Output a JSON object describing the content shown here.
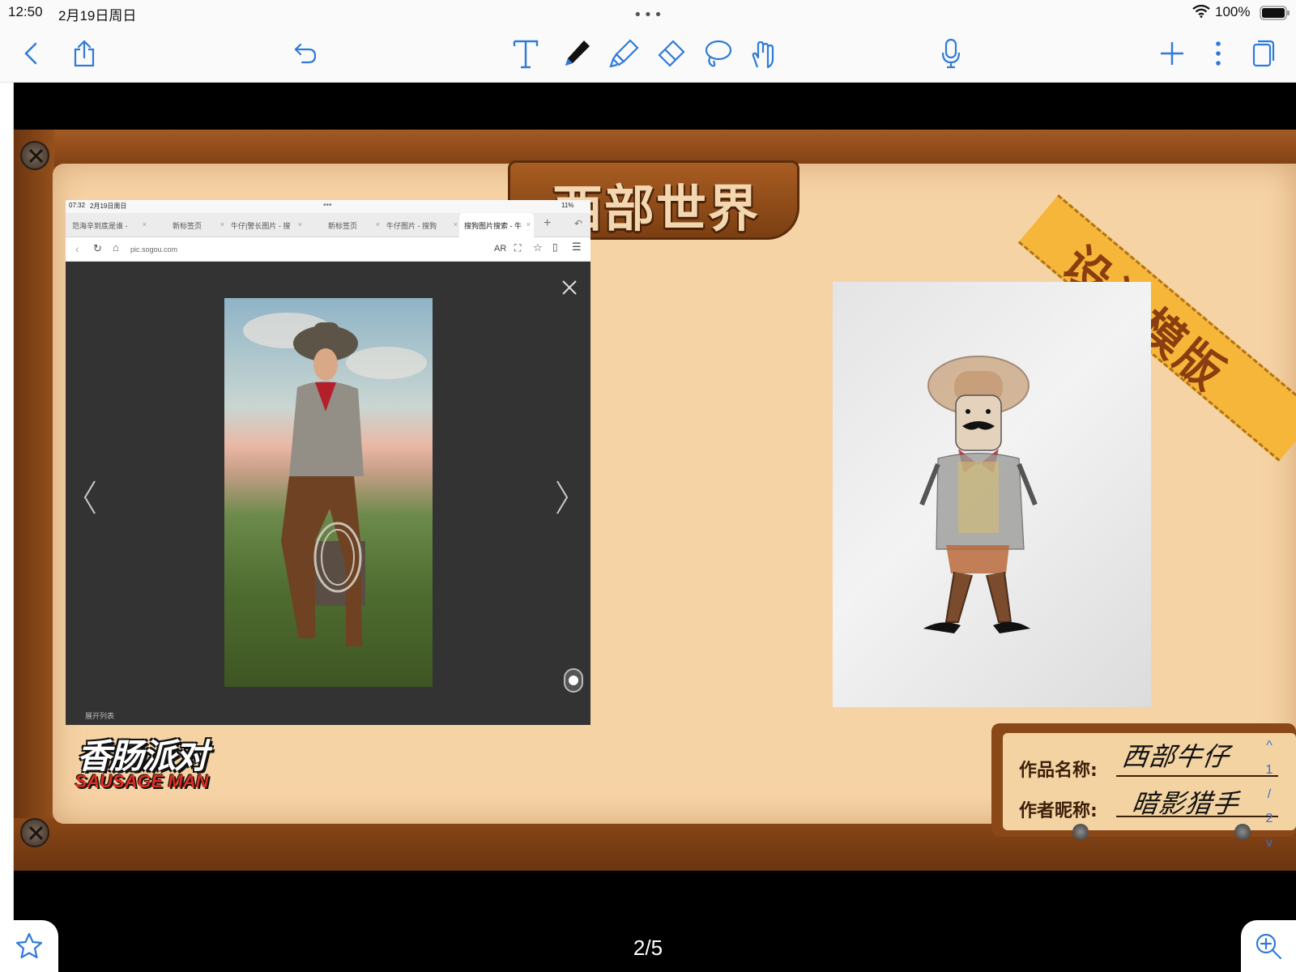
{
  "status_bar": {
    "time": "12:50",
    "date": "2月19日周日",
    "battery": "100%"
  },
  "toolbar": {
    "tools": [
      "back",
      "share",
      "undo",
      "text",
      "pen",
      "highlighter",
      "eraser",
      "lasso",
      "hand",
      "microphone",
      "add",
      "more",
      "pages"
    ],
    "accent_color": "#2f7ad8"
  },
  "slide": {
    "title": "西部世界",
    "ribbon": "设计模版",
    "logo_cn": "香肠派对",
    "logo_en": "SAUSAGE MAN",
    "card": {
      "work_name_label": "作品名称:",
      "work_name_value": "西部牛仔",
      "author_label": "作者昵称:",
      "author_value": "暗影猎手"
    }
  },
  "embedded_screenshot": {
    "time": "07:32",
    "date": "2月19日周日",
    "battery": "11%",
    "tabs": [
      {
        "label": "范海辛到底是谁 -",
        "active": false
      },
      {
        "label": "新标签页",
        "active": false
      },
      {
        "label": "牛仔|警长图片 - 搜",
        "active": false
      },
      {
        "label": "新标签页",
        "active": false
      },
      {
        "label": "牛仔图片 - 搜狗",
        "active": false
      },
      {
        "label": "搜狗图片搜索 - 牛",
        "active": true
      }
    ],
    "url": "pic.sogou.com",
    "ar_label": "AR",
    "expand_list": "展开列表"
  },
  "page_indicator": [
    "^",
    "1",
    "/",
    "2",
    "v"
  ],
  "page_counter": "2/5"
}
